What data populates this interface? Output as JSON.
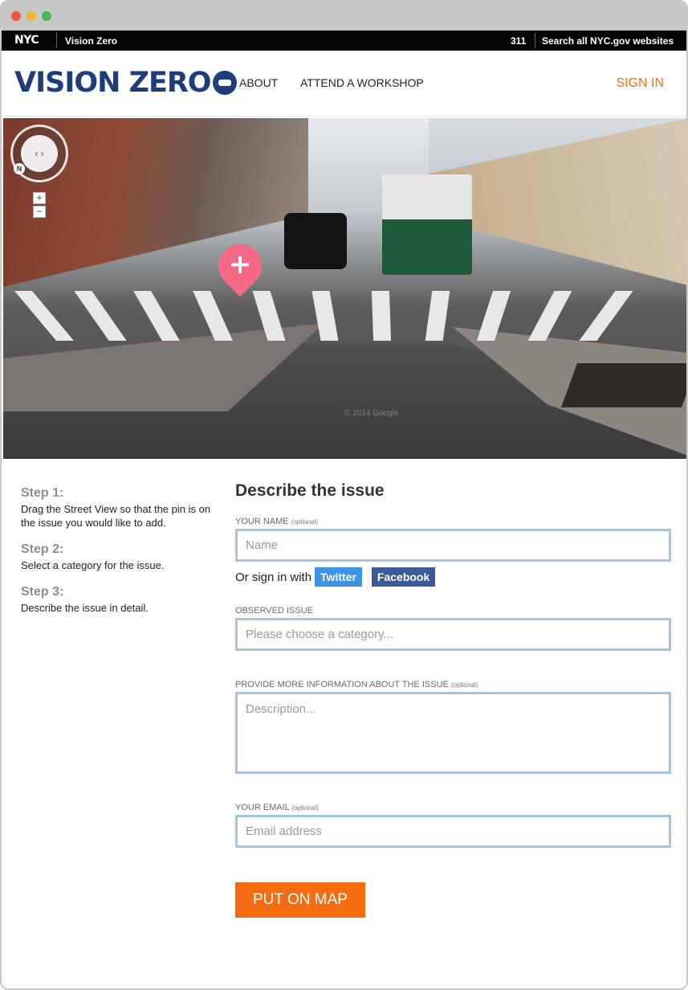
{
  "nyc_bar": {
    "logo": "NYC",
    "site": "Vision Zero",
    "phone": "311",
    "search": "Search all NYC.gov websites"
  },
  "header": {
    "logo": "VISION ZERO",
    "nav": [
      "ABOUT",
      "ATTEND A WORKSHOP"
    ],
    "signin": "SIGN IN"
  },
  "streetview": {
    "zoom_in": "+",
    "zoom_out": "−",
    "compass": "N",
    "watermark": "© 2014 Google"
  },
  "steps": [
    {
      "title": "Step 1:",
      "text": "Drag the Street View so that the pin is on the issue you would like to add."
    },
    {
      "title": "Step 2:",
      "text": "Select a category for the issue."
    },
    {
      "title": "Step 3:",
      "text": "Describe the issue in detail."
    }
  ],
  "form": {
    "title": "Describe the issue",
    "name_label": "YOUR NAME",
    "name_optional": "(optional)",
    "name_placeholder": "Name",
    "signin_text": "Or sign in with",
    "twitter": "Twitter",
    "facebook": "Facebook",
    "issue_label": "OBSERVED ISSUE",
    "issue_placeholder": "Please choose a category...",
    "info_label": "PROVIDE MORE INFORMATION ABOUT THE ISSUE",
    "info_optional": "(optional)",
    "info_placeholder": "Description...",
    "email_label": "YOUR EMAIL",
    "email_optional": "(optional)",
    "email_placeholder": "Email address",
    "submit": "PUT ON MAP"
  },
  "colors": {
    "accent": "#f36c10",
    "brand": "#1f3d7a",
    "field_border": "#aac3da",
    "pin": "#f26a86",
    "twitter": "#3b94e5",
    "facebook": "#3b5a98"
  }
}
